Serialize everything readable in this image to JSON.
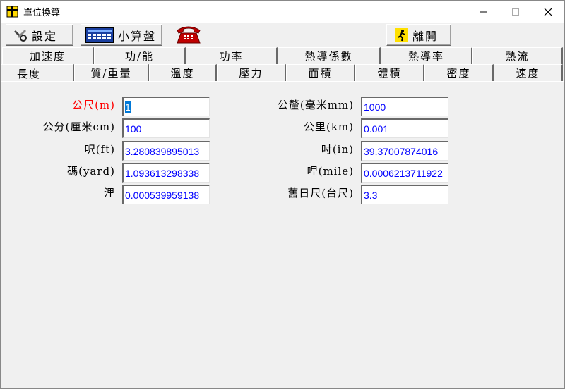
{
  "window": {
    "title": "單位換算"
  },
  "toolbar": {
    "settings_label": "設定",
    "calc_label": "小算盤",
    "exit_label": "離開"
  },
  "tabs": {
    "row1": [
      "加速度",
      "功/能",
      "功率",
      "熱導係數",
      "熱導率",
      "熱流"
    ],
    "row2": [
      "長度",
      "質/重量",
      "溫度",
      "壓力",
      "面積",
      "體積",
      "密度",
      "速度"
    ],
    "active": "長度"
  },
  "fields": {
    "left": [
      {
        "label": "公尺(m)",
        "value": "1"
      },
      {
        "label": "公分(厘米cm)",
        "value": "100"
      },
      {
        "label": "呎(ft)",
        "value": "3.280839895013"
      },
      {
        "label": "碼(yard)",
        "value": "1.093613298338"
      },
      {
        "label": "浬",
        "value": "0.000539959138"
      }
    ],
    "right": [
      {
        "label": "公釐(毫米mm)",
        "value": "1000"
      },
      {
        "label": "公里(km)",
        "value": "0.001"
      },
      {
        "label": "吋(in)",
        "value": "39.37007874016"
      },
      {
        "label": "哩(mile)",
        "value": "0.0006213711922"
      },
      {
        "label": "舊日尺(台尺)",
        "value": "3.3"
      }
    ]
  },
  "colors": {
    "active_label": "#ff0000",
    "value_text": "#0000ff",
    "selection": "#0078d7"
  }
}
